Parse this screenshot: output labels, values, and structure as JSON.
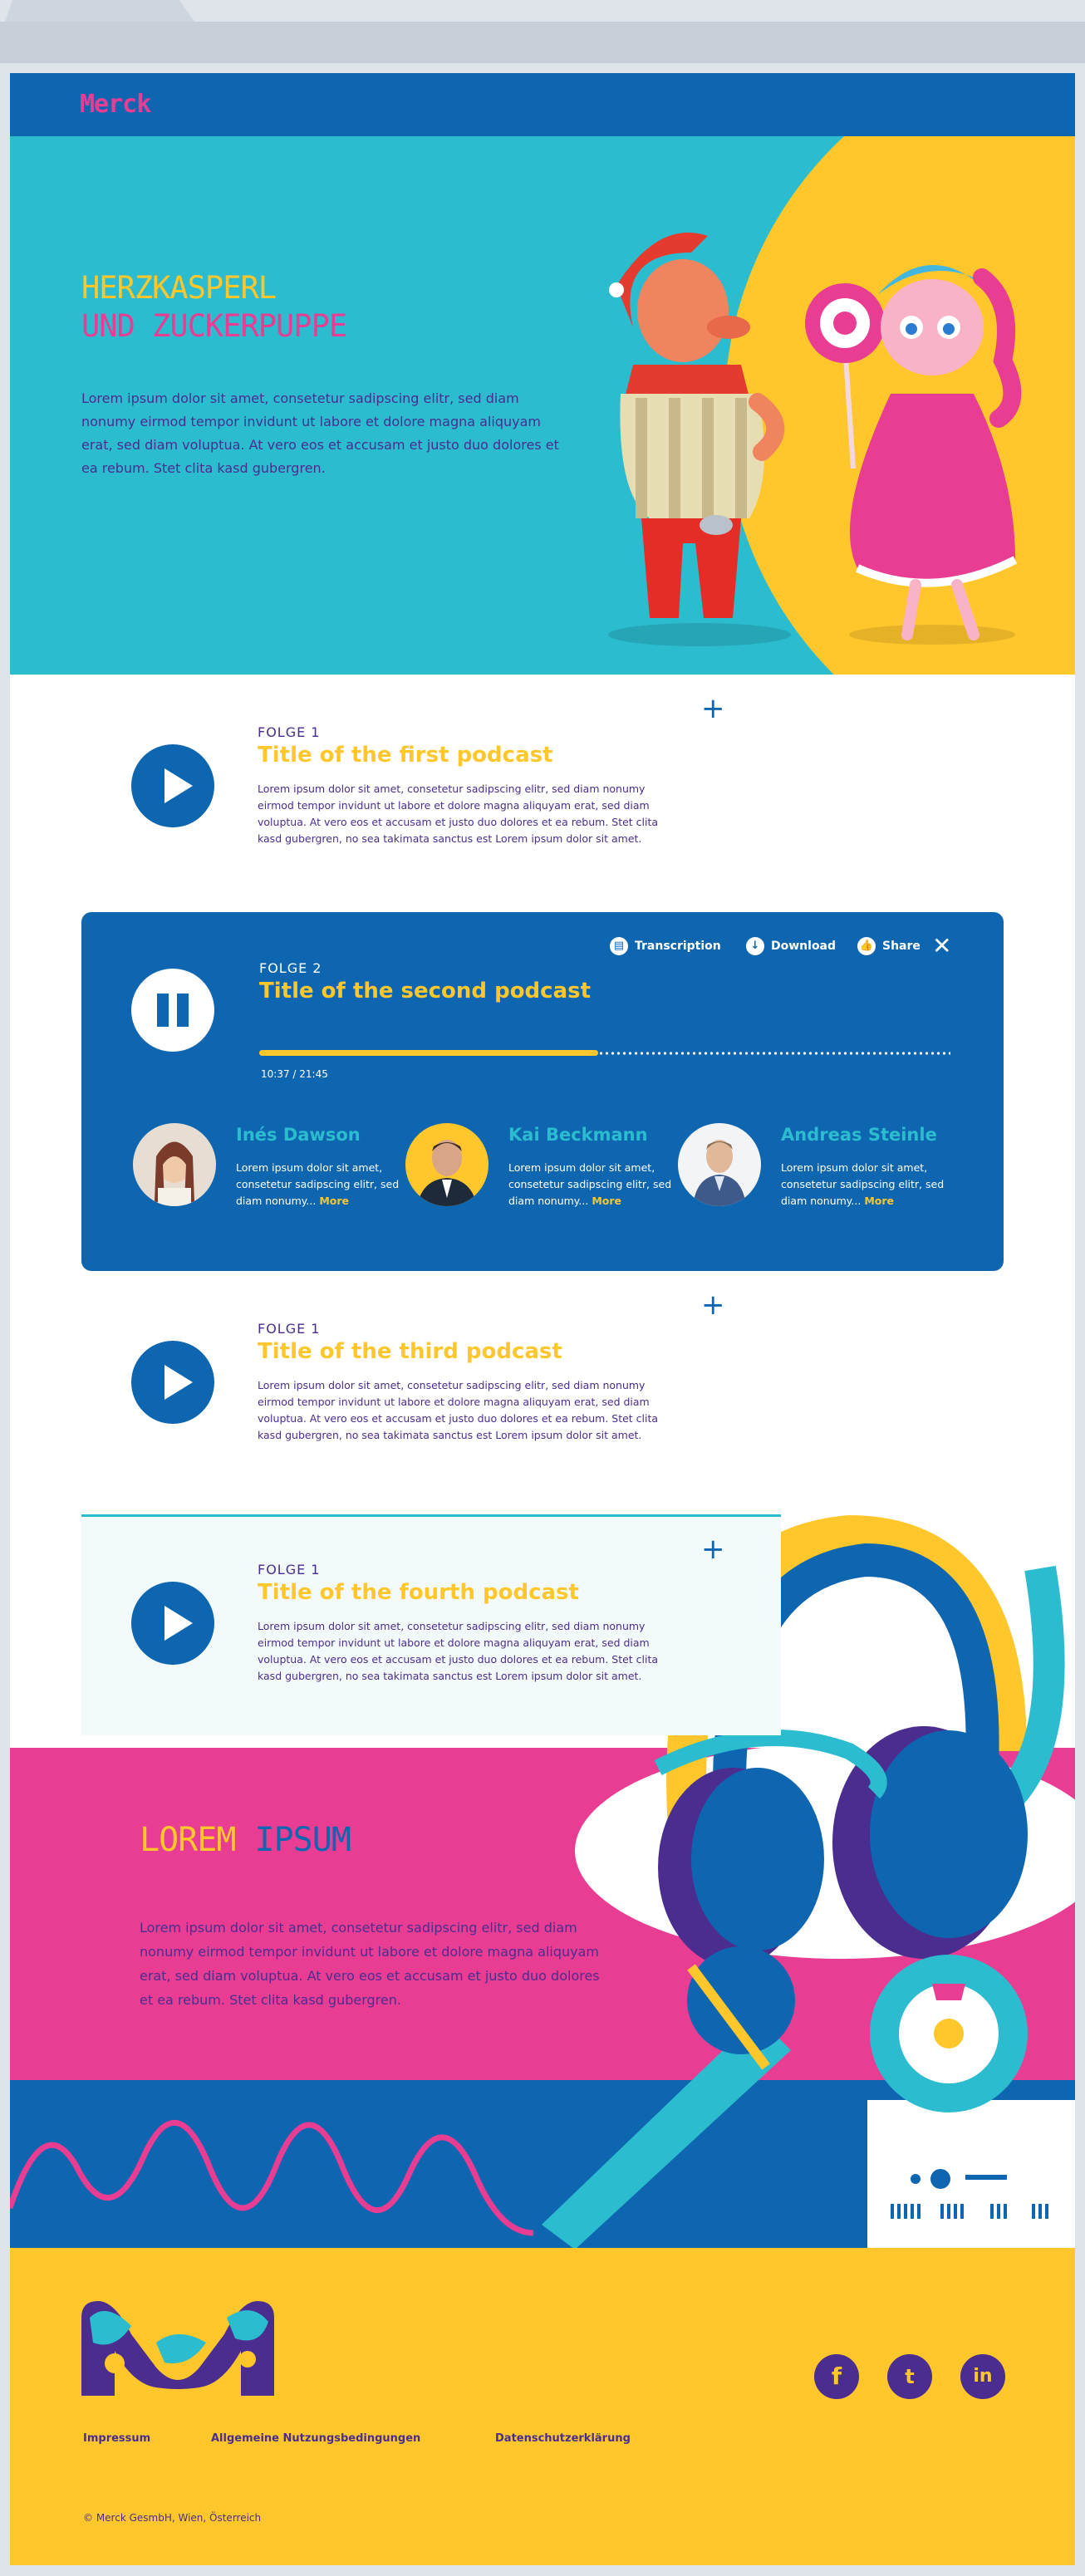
{
  "brand": {
    "logo": "Merck"
  },
  "hero": {
    "line1": "HERZKASPERL",
    "line2": "UND ZUCKERPUPPE",
    "text": "Lorem ipsum dolor sit amet, consetetur sadipscing elitr, sed diam nonumy eirmod tempor invidunt ut labore et dolore magna aliquyam erat, sed diam voluptua. At vero eos et accusam et justo duo dolores et ea rebum. Stet clita kasd gubergren."
  },
  "podcasts": [
    {
      "folge": "FOLGE 1",
      "title": "Title of the first podcast",
      "desc": "Lorem ipsum dolor sit amet, consetetur sadipscing elitr, sed diam nonumy eirmod tempor invidunt ut labore et dolore magna aliquyam erat, sed diam voluptua. At vero eos et accusam et justo duo dolores et ea rebum. Stet clita kasd gubergren, no sea takimata sanctus est Lorem ipsum dolor sit amet.",
      "plus": "+"
    },
    {
      "folge": "FOLGE 2",
      "title": "Title of the second podcast"
    },
    {
      "folge": "FOLGE 1",
      "title": "Title of the third podcast",
      "desc": "Lorem ipsum dolor sit amet, consetetur sadipscing elitr, sed diam nonumy eirmod tempor invidunt ut labore et dolore magna aliquyam erat, sed diam voluptua. At vero eos et accusam et justo duo dolores et ea rebum. Stet clita kasd gubergren, no sea takimata sanctus est Lorem ipsum dolor sit amet.",
      "plus": "+"
    },
    {
      "folge": "FOLGE 1",
      "title": "Title of the fourth podcast",
      "desc": "Lorem ipsum dolor sit amet, consetetur sadipscing elitr, sed diam nonumy eirmod tempor invidunt ut labore et dolore magna aliquyam erat, sed diam voluptua. At vero eos et accusam et justo duo dolores et ea rebum. Stet clita kasd gubergren, no sea takimata sanctus est Lorem ipsum dolor sit amet.",
      "plus": "+"
    }
  ],
  "player": {
    "time": "10:37 / 21:45",
    "progress": 0.49,
    "actions": {
      "transcription": "Transcription",
      "download": "Download",
      "share": "Share",
      "close": "✕"
    },
    "people": [
      {
        "name": "Inés Dawson",
        "bio": "Lorem ipsum dolor sit amet, consetetur sadipscing elitr, sed diam nonumy...",
        "more": "More"
      },
      {
        "name": "Kai Beckmann",
        "bio": "Lorem ipsum dolor sit amet, consetetur sadipscing elitr, sed diam nonumy...",
        "more": "More"
      },
      {
        "name": "Andreas Steinle",
        "bio": "Lorem ipsum dolor sit amet, consetetur sadipscing elitr, sed diam nonumy...",
        "more": "More"
      }
    ]
  },
  "promo": {
    "word1": "LOREM",
    "word2": "IPSUM",
    "text": "Lorem ipsum dolor sit amet, consetetur sadipscing elitr, sed diam nonumy eirmod tempor invidunt ut labore et dolore magna aliquyam erat, sed diam voluptua. At vero eos et accusam et justo duo dolores et ea rebum. Stet clita kasd gubergren."
  },
  "footer": {
    "links": [
      "Impressum",
      "Allgemeine Nutzungsbedingungen",
      "Datenschutzerklärung"
    ],
    "copyright": "© Merck GesmbH, Wien, Österreich",
    "social": {
      "facebook": "f",
      "twitter": "t",
      "linkedin": "in"
    }
  },
  "colors": {
    "blue": "#0f66b0",
    "cyan": "#2bbcd0",
    "yellow": "#ffc72c",
    "pink": "#e93d94",
    "purple": "#4a2d8f"
  }
}
